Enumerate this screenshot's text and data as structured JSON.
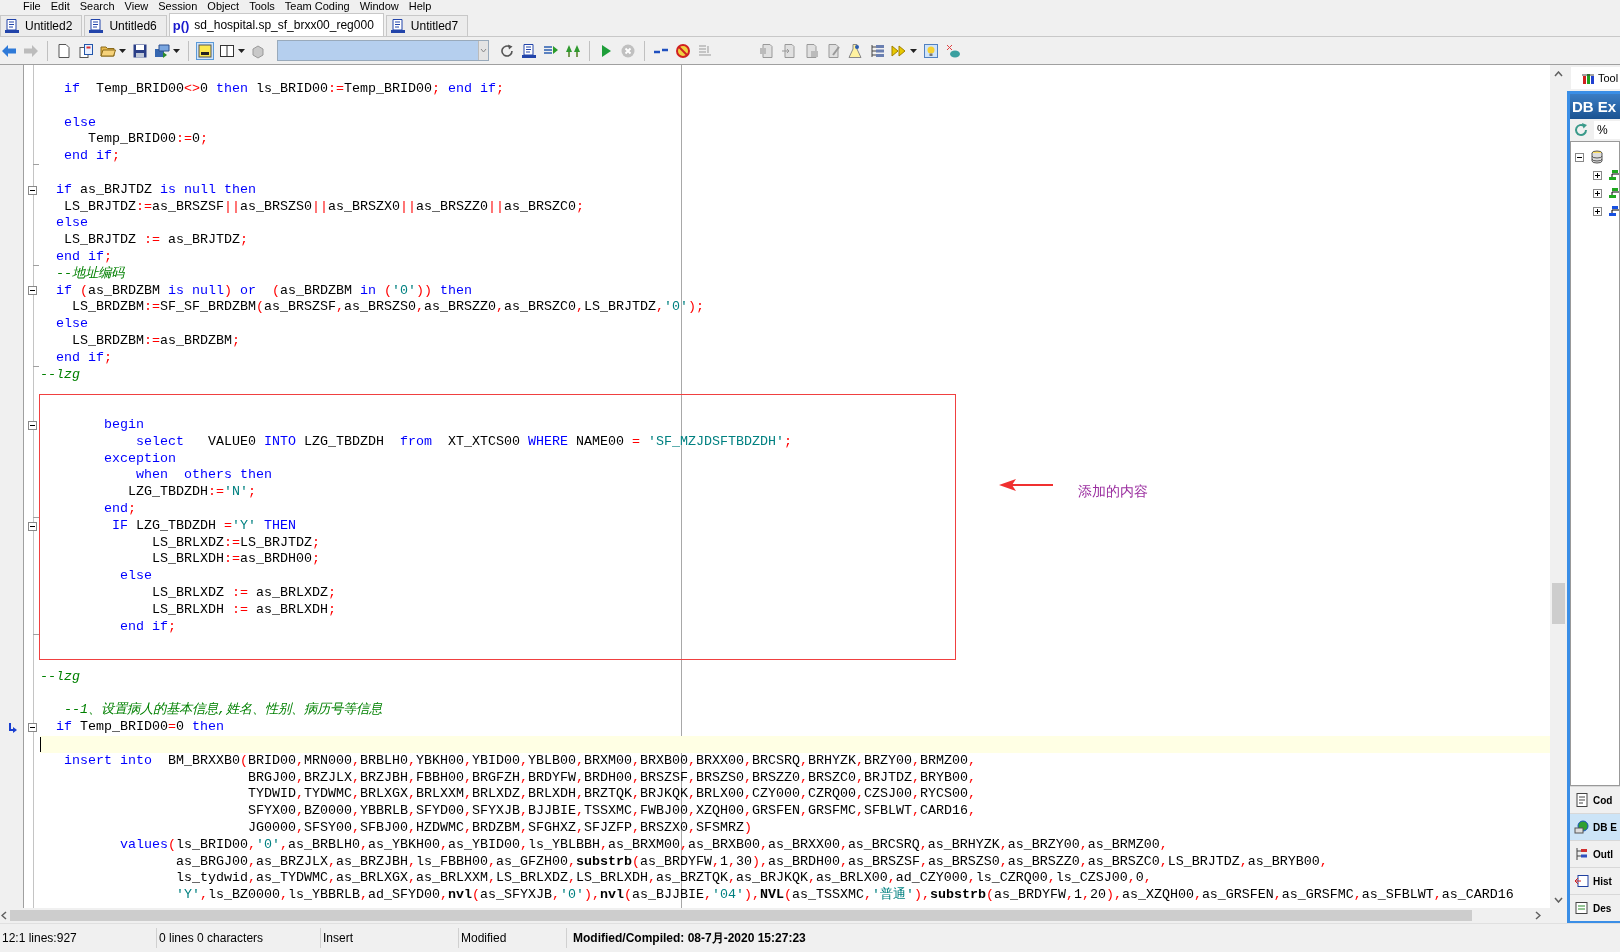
{
  "menu": [
    "File",
    "Edit",
    "Search",
    "View",
    "Session",
    "Object",
    "Tools",
    "Team Coding",
    "Window",
    "Help"
  ],
  "tabs": [
    {
      "label": "Untitled2",
      "kind": "sql",
      "selected": false
    },
    {
      "label": "Untitled6",
      "kind": "sql",
      "selected": false
    },
    {
      "label": "sd_hospital.sp_sf_brxx00_reg000",
      "kind": "procedure",
      "badge": "p()",
      "selected": true
    },
    {
      "label": "Untitled7",
      "kind": "sql",
      "selected": false
    }
  ],
  "editor": {
    "lines": [
      {
        "kind": "plain",
        "segments": [
          {
            "kind": "kw",
            "text": "   if"
          },
          {
            "kind": "tx",
            "text": "  Temp_BRID00<>0 "
          },
          {
            "kind": "kw",
            "text": "then"
          },
          {
            "kind": "tx",
            "text": " ls_BRID00:=Temp_BRID00; "
          },
          {
            "kind": "kw",
            "text": "end if"
          },
          {
            "kind": "tx",
            "text": ";"
          }
        ],
        "current": false,
        "marked": false
      },
      {
        "kind": "plain",
        "current": false,
        "marked": false
      },
      {
        "kind": "plain",
        "segments": [
          {
            "kind": "kw",
            "text": "   else"
          }
        ],
        "current": false,
        "marked": false
      },
      {
        "kind": "plain",
        "segments": [
          {
            "kind": "tx",
            "text": "      Temp_BRID00:=0;"
          }
        ],
        "current": false,
        "marked": false
      },
      {
        "kind": "fold-end",
        "segments": [
          {
            "kind": "kw",
            "text": "   end if"
          },
          {
            "kind": "tx",
            "text": ";"
          }
        ],
        "current": false,
        "marked": false
      },
      {
        "kind": "plain",
        "current": false,
        "marked": false
      },
      {
        "kind": "fold-start",
        "segments": [
          {
            "kind": "kw",
            "text": "  if"
          },
          {
            "kind": "tx",
            "text": " as_BRJTDZ "
          },
          {
            "kind": "kw",
            "text": "is null then"
          }
        ],
        "current": false,
        "marked": false
      },
      {
        "kind": "plain",
        "segments": [
          {
            "kind": "tx",
            "text": "   LS_BRJTDZ:=as_BRSZSF||as_BRSZS0||as_BRSZX0||as_BRSZZ0||as_BRSZC0;"
          }
        ],
        "current": false,
        "marked": false
      },
      {
        "kind": "plain",
        "segments": [
          {
            "kind": "kw",
            "text": "  else"
          }
        ],
        "current": false,
        "marked": false
      },
      {
        "kind": "plain",
        "segments": [
          {
            "kind": "tx",
            "text": "   LS_BRJTDZ := as_BRJTDZ;"
          }
        ],
        "current": false,
        "marked": false
      },
      {
        "kind": "fold-end",
        "segments": [
          {
            "kind": "kw",
            "text": "  end if"
          },
          {
            "kind": "tx",
            "text": ";"
          }
        ],
        "current": false,
        "marked": false
      },
      {
        "kind": "plain",
        "segments": [
          {
            "kind": "cm",
            "text": "  --地址编码"
          }
        ],
        "current": false,
        "marked": false
      },
      {
        "kind": "fold-start",
        "segments": [
          {
            "kind": "kw",
            "text": "  if"
          },
          {
            "kind": "tx",
            "text": " (as_BRDZBM "
          },
          {
            "kind": "kw",
            "text": "is null"
          },
          {
            "kind": "tx",
            "text": ") "
          },
          {
            "kind": "kw",
            "text": "or"
          },
          {
            "kind": "tx",
            "text": "  (as_BRDZBM "
          },
          {
            "kind": "kw",
            "text": "in"
          },
          {
            "kind": "tx",
            "text": " ('0')) "
          },
          {
            "kind": "kw",
            "text": "then"
          }
        ],
        "current": false,
        "marked": false
      },
      {
        "kind": "plain",
        "segments": [
          {
            "kind": "tx",
            "text": "    LS_BRDZBM:=SF_SF_BRDZBM(as_BRSZSF,as_BRSZS0,as_BRSZZ0,as_BRSZC0,LS_BRJTDZ,'0');"
          }
        ],
        "current": false,
        "marked": false
      },
      {
        "kind": "plain",
        "segments": [
          {
            "kind": "kw",
            "text": "  else"
          }
        ],
        "current": false,
        "marked": false
      },
      {
        "kind": "plain",
        "segments": [
          {
            "kind": "tx",
            "text": "    LS_BRDZBM:=as_BRDZBM;"
          }
        ],
        "current": false,
        "marked": false
      },
      {
        "kind": "fold-end",
        "segments": [
          {
            "kind": "kw",
            "text": "  end if"
          },
          {
            "kind": "tx",
            "text": ";"
          }
        ],
        "current": false,
        "marked": false
      },
      {
        "kind": "plain",
        "segments": [
          {
            "kind": "cm",
            "text": "--lzg"
          }
        ],
        "current": false,
        "marked": false
      },
      {
        "kind": "plain",
        "current": false,
        "marked": false
      },
      {
        "kind": "plain",
        "current": false,
        "marked": false
      },
      {
        "kind": "fold-start",
        "segments": [
          {
            "kind": "kw",
            "text": "        begin"
          }
        ],
        "current": false,
        "marked": false
      },
      {
        "kind": "plain",
        "segments": [
          {
            "kind": "kw",
            "text": "            select"
          },
          {
            "kind": "tx",
            "text": "   VALUE0 "
          },
          {
            "kind": "kw",
            "text": "INTO"
          },
          {
            "kind": "tx",
            "text": " LZG_TBDZDH  "
          },
          {
            "kind": "kw",
            "text": "from"
          },
          {
            "kind": "tx",
            "text": "  XT_XTCS00 "
          },
          {
            "kind": "kw",
            "text": "WHERE"
          },
          {
            "kind": "tx",
            "text": " NAME00 = 'SF_MZJDSFTBDZDH';"
          }
        ],
        "current": false,
        "marked": false
      },
      {
        "kind": "plain",
        "segments": [
          {
            "kind": "kw",
            "text": "        exception"
          }
        ],
        "current": false,
        "marked": false
      },
      {
        "kind": "plain",
        "segments": [
          {
            "kind": "kw",
            "text": "            when  others then"
          }
        ],
        "current": false,
        "marked": false
      },
      {
        "kind": "plain",
        "segments": [
          {
            "kind": "tx",
            "text": "           LZG_TBDZDH:='N';"
          }
        ],
        "current": false,
        "marked": false
      },
      {
        "kind": "fold-end",
        "segments": [
          {
            "kind": "kw",
            "text": "        end"
          },
          {
            "kind": "tx",
            "text": ";"
          }
        ],
        "current": false,
        "marked": false
      },
      {
        "kind": "fold-start",
        "segments": [
          {
            "kind": "kw",
            "text": "         IF"
          },
          {
            "kind": "tx",
            "text": " LZG_TBDZDH ='Y' "
          },
          {
            "kind": "kw",
            "text": "THEN"
          }
        ],
        "current": false,
        "marked": false
      },
      {
        "kind": "plain",
        "segments": [
          {
            "kind": "tx",
            "text": "              LS_BRLXDZ:=LS_BRJTDZ;"
          }
        ],
        "current": false,
        "marked": false
      },
      {
        "kind": "plain",
        "segments": [
          {
            "kind": "tx",
            "text": "              LS_BRLXDH:=as_BRDH00;"
          }
        ],
        "current": false,
        "marked": false
      },
      {
        "kind": "plain",
        "segments": [
          {
            "kind": "kw",
            "text": "          else"
          }
        ],
        "current": false,
        "marked": false
      },
      {
        "kind": "plain",
        "segments": [
          {
            "kind": "tx",
            "text": "              LS_BRLXDZ := as_BRLXDZ;"
          }
        ],
        "current": false,
        "marked": false
      },
      {
        "kind": "plain",
        "segments": [
          {
            "kind": "tx",
            "text": "              LS_BRLXDH := as_BRLXDH;"
          }
        ],
        "current": false,
        "marked": false
      },
      {
        "kind": "fold-end",
        "segments": [
          {
            "kind": "kw",
            "text": "          end if"
          },
          {
            "kind": "tx",
            "text": ";"
          }
        ],
        "current": false,
        "marked": false
      },
      {
        "kind": "plain",
        "current": false,
        "marked": false
      },
      {
        "kind": "plain",
        "current": false,
        "marked": false
      },
      {
        "kind": "plain",
        "segments": [
          {
            "kind": "cm",
            "text": "--lzg"
          }
        ],
        "current": false,
        "marked": false
      },
      {
        "kind": "plain",
        "current": false,
        "marked": false
      },
      {
        "kind": "plain",
        "segments": [
          {
            "kind": "cm",
            "text": "   --1、设置病人的基本信息,姓名、性别、病历号等信息"
          }
        ],
        "current": false,
        "marked": false
      },
      {
        "kind": "fold-start",
        "segments": [
          {
            "kind": "kw",
            "text": "  if"
          },
          {
            "kind": "tx",
            "text": " Temp_BRID00=0 "
          },
          {
            "kind": "kw",
            "text": "then"
          }
        ],
        "current": false,
        "marked": true
      },
      {
        "kind": "plain",
        "current": true,
        "marked": false
      },
      {
        "kind": "plain",
        "segments": [
          {
            "kind": "kw",
            "text": "   insert into"
          },
          {
            "kind": "tx",
            "text": "  BM_BRXXB0(BRID00,MRN000,BRBLH0,YBKH00,YBID00,YBLB00,BRXM00,BRXB00,BRXX00,BRCSRQ,BRHYZK,BRZY00,BRMZ00,"
          }
        ],
        "current": false,
        "marked": false
      },
      {
        "kind": "plain",
        "segments": [
          {
            "kind": "tx",
            "text": "                          BRGJ00,BRZJLX,BRZJBH,FBBH00,BRGFZH,BRDYFW,BRDH00,BRSZSF,BRSZS0,BRSZZ0,BRSZC0,BRJTDZ,BRYB00,"
          }
        ],
        "current": false,
        "marked": false
      },
      {
        "kind": "plain",
        "segments": [
          {
            "kind": "tx",
            "text": "                          TYDWID,TYDWMC,BRLXGX,BRLXXM,BRLXDZ,BRLXDH,BRZTQK,BRJKQK,BRLX00,CZY000,CZRQ00,CZSJ00,RYCS00,"
          }
        ],
        "current": false,
        "marked": false
      },
      {
        "kind": "plain",
        "segments": [
          {
            "kind": "tx",
            "text": "                          SFYX00,BZ0000,YBBRLB,SFYD00,SFYXJB,BJJBIE,TSSXMC,FWBJ00,XZQH00,GRSFEN,GRSFMC,SFBLWT,CARD16,"
          }
        ],
        "current": false,
        "marked": false
      },
      {
        "kind": "plain",
        "segments": [
          {
            "kind": "tx",
            "text": "                          JG0000,SFSY00,SFBJ00,HZDWMC,BRDZBM,SFGHXZ,SFJZFP,BRSZX0,SFSMRZ)"
          }
        ],
        "current": false,
        "marked": false
      },
      {
        "kind": "plain",
        "segments": [
          {
            "kind": "kw",
            "text": "          values"
          },
          {
            "kind": "tx",
            "text": "(ls_BRID00,'0',as_BRBLH0,as_YBKH00,as_YBID00,ls_YBLBBH,as_BRXM00,as_BRXB00,as_BRXX00,as_BRCSRQ,as_BRHYZK,as_BRZY00,as_BRMZ00,"
          }
        ],
        "current": false,
        "marked": false
      },
      {
        "kind": "plain",
        "segments": [
          {
            "kind": "tx",
            "text": "                 as_BRGJ00,as_BRZJLX,as_BRZJBH,ls_FBBH00,as_GFZH00,"
          },
          {
            "kind": "fn",
            "text": "substrb"
          },
          {
            "kind": "tx",
            "text": "(as_BRDYFW,1,30),as_BRDH00,as_BRSZSF,as_BRSZS0,as_BRSZZ0,as_BRSZC0,LS_BRJTDZ,as_BRYB00,"
          }
        ],
        "current": false,
        "marked": false
      },
      {
        "kind": "plain",
        "segments": [
          {
            "kind": "tx",
            "text": "                 ls_tydwid,as_TYDWMC,as_BRLXGX,as_BRLXXM,LS_BRLXDZ,LS_BRLXDH,as_BRZTQK,as_BRJKQK,as_BRLX00,ad_CZY000,ls_CZRQ00,ls_CZSJ00,0,"
          }
        ],
        "current": false,
        "marked": false
      },
      {
        "kind": "plain",
        "segments": [
          {
            "kind": "tx",
            "text": "                 'Y',ls_BZ0000,ls_YBBRLB,ad_SFYD00,"
          },
          {
            "kind": "fn",
            "text": "nvl"
          },
          {
            "kind": "tx",
            "text": "(as_SFYXJB,'0'),"
          },
          {
            "kind": "fn",
            "text": "nvl"
          },
          {
            "kind": "tx",
            "text": "(as_BJJBIE,'04'),"
          },
          {
            "kind": "fn",
            "text": "NVL"
          },
          {
            "kind": "tx",
            "text": "(as_TSSXMC,'普通'),"
          },
          {
            "kind": "fn",
            "text": "substrb"
          },
          {
            "kind": "tx",
            "text": "(as_BRDYFW,1,20),as_XZQH00,as_GRSFEN,as_GRSFMC,as_SFBLWT,as_CARD16"
          }
        ],
        "current": false,
        "marked": false
      }
    ],
    "annotation": {
      "label": "添加的内容"
    }
  },
  "panel": {
    "title": "Tool",
    "header": "DB Ex",
    "filter": "%",
    "tree": [
      {
        "expanded": true,
        "children": [
          {
            "expanded": false,
            "color": "#1fa81f"
          },
          {
            "expanded": false,
            "color": "#1fa81f"
          },
          {
            "expanded": false,
            "color": "#1650e0"
          }
        ]
      }
    ],
    "tabs": [
      {
        "label": "Cod",
        "selected": false
      },
      {
        "label": "DB E",
        "selected": true
      },
      {
        "label": "Outl",
        "selected": false
      },
      {
        "label": "Hist",
        "selected": false
      },
      {
        "label": "Des",
        "selected": false
      }
    ]
  },
  "status_bar": [
    {
      "text": "12:1 lines:927",
      "kind": "plain"
    },
    {
      "text": "0 lines 0 characters",
      "kind": "plain"
    },
    {
      "text": "Insert",
      "kind": "plain"
    },
    {
      "text": "Modified",
      "kind": "plain"
    },
    {
      "text": "Modified/Compiled: 08-7月-2020 15:27:23",
      "kind": "strong"
    }
  ]
}
